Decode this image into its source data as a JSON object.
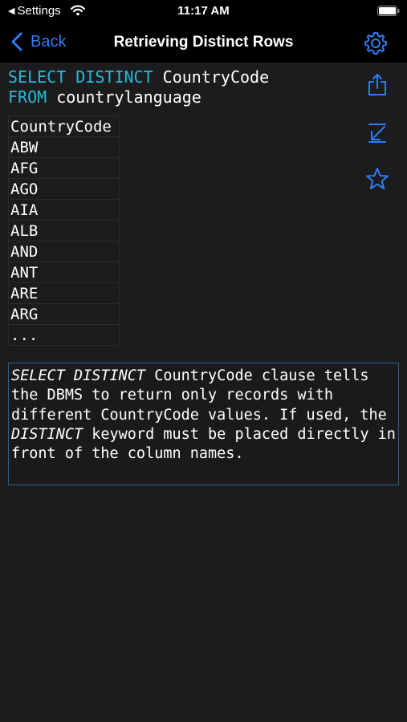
{
  "status_bar": {
    "back_app": "Settings",
    "time": "11:17 AM"
  },
  "nav": {
    "back_label": "Back",
    "title": "Retrieving Distinct Rows",
    "accent_color": "#2f7cf6"
  },
  "query": {
    "line1_kw": "SELECT DISTINCT",
    "line1_rest": " CountryCode",
    "line2_kw": "FROM",
    "line2_rest": " countrylanguage",
    "keyword_color": "#2bb8d6"
  },
  "result": {
    "column": "CountryCode",
    "rows": [
      "ABW",
      "AFG",
      "AGO",
      "AIA",
      "ALB",
      "AND",
      "ANT",
      "ARE",
      "ARG",
      "..."
    ]
  },
  "explanation": {
    "part1_italic": "SELECT DISTINCT",
    "part2": " CountryCode clause tells the DBMS to return only records with different CountryCode values. If used, the ",
    "part3_italic": "DISTINCT",
    "part4": " keyword must be placed directly in front of the column names."
  },
  "side_actions": [
    "share-icon",
    "export-icon",
    "favorite-star-icon"
  ]
}
